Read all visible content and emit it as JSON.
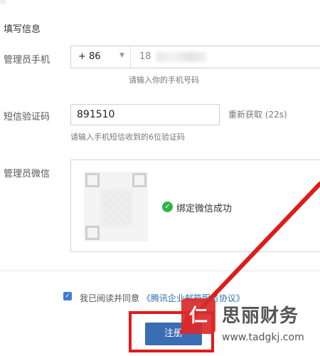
{
  "section": {
    "title": "填写信息"
  },
  "phone": {
    "label": "管理员手机",
    "country_code": "+ 86",
    "value_visible": "18",
    "hint": "请输入你的手机号码"
  },
  "sms": {
    "label": "短信验证码",
    "value": "891510",
    "resend": "重新获取 (22s)",
    "hint": "请输入手机短信收到的6位验证码"
  },
  "wechat": {
    "label": "管理员微信",
    "status": "绑定微信成功"
  },
  "agreement": {
    "prefix": "我已阅读并同意",
    "link": "《腾讯企业邮箱服务协议》",
    "checked": true
  },
  "register_button": "注册",
  "watermark": {
    "logo_char": "仁",
    "name": "思丽财务",
    "url": "www.tadgkj.com"
  },
  "colors": {
    "primary_button": "#3b6db5",
    "success": "#2fb344",
    "highlight_red": "#e01b1b",
    "link": "#2f6fb5"
  }
}
